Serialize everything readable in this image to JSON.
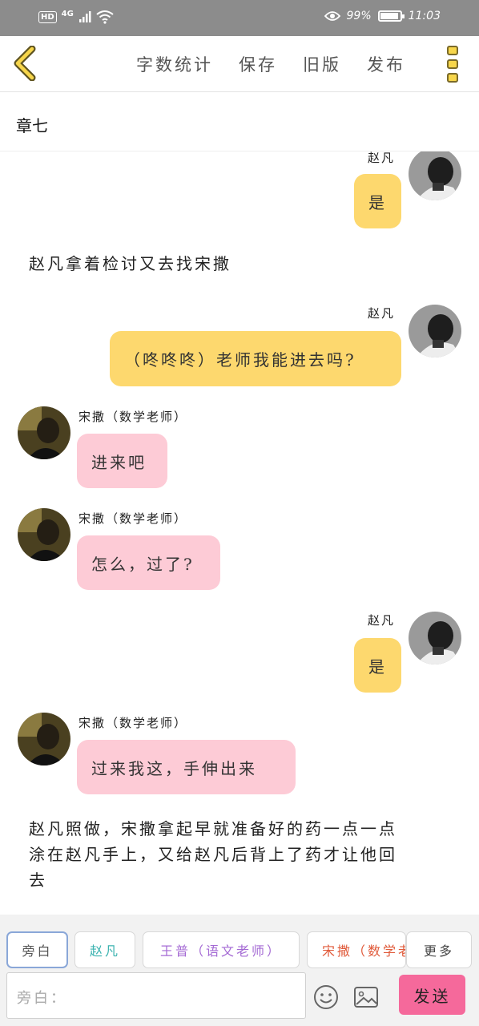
{
  "status_bar": {
    "network": "4G",
    "battery": "99%",
    "time": "11:03"
  },
  "toolbar": {
    "word_count": "字数统计",
    "save": "保存",
    "old_version": "旧版",
    "publish": "发布"
  },
  "chapter": {
    "title": "章七"
  },
  "messages": [
    {
      "type": "right",
      "sender": "赵凡",
      "text": "是"
    },
    {
      "type": "narration",
      "text": "赵凡拿着检讨又去找宋撒"
    },
    {
      "type": "right",
      "sender": "赵凡",
      "text": "（咚咚咚）老师我能进去吗?"
    },
    {
      "type": "left",
      "sender": "宋撒（数学老师）",
      "text": "进来吧"
    },
    {
      "type": "left",
      "sender": "宋撒（数学老师）",
      "text": "怎么，过了?"
    },
    {
      "type": "right",
      "sender": "赵凡",
      "text": "是"
    },
    {
      "type": "left",
      "sender": "宋撒（数学老师）",
      "text": "过来我这，手伸出来"
    },
    {
      "type": "narration",
      "text_lines": [
        "赵凡照做，宋撒拿起早就准备好的药一点一点",
        "涂在赵凡手上，又给赵凡后背上了药才让他回",
        "去"
      ]
    }
  ],
  "roles": [
    {
      "label": "旁白",
      "color": "#555555"
    },
    {
      "label": "赵凡",
      "color": "#3bb3b0"
    },
    {
      "label": "王普（语文老师）",
      "color": "#a46ad4"
    },
    {
      "label": "宋撒（数学老师）",
      "color": "#e05a3a"
    },
    {
      "label": "更多",
      "color": "#444444"
    }
  ],
  "input": {
    "placeholder": "旁白："
  },
  "send_label": "发送"
}
